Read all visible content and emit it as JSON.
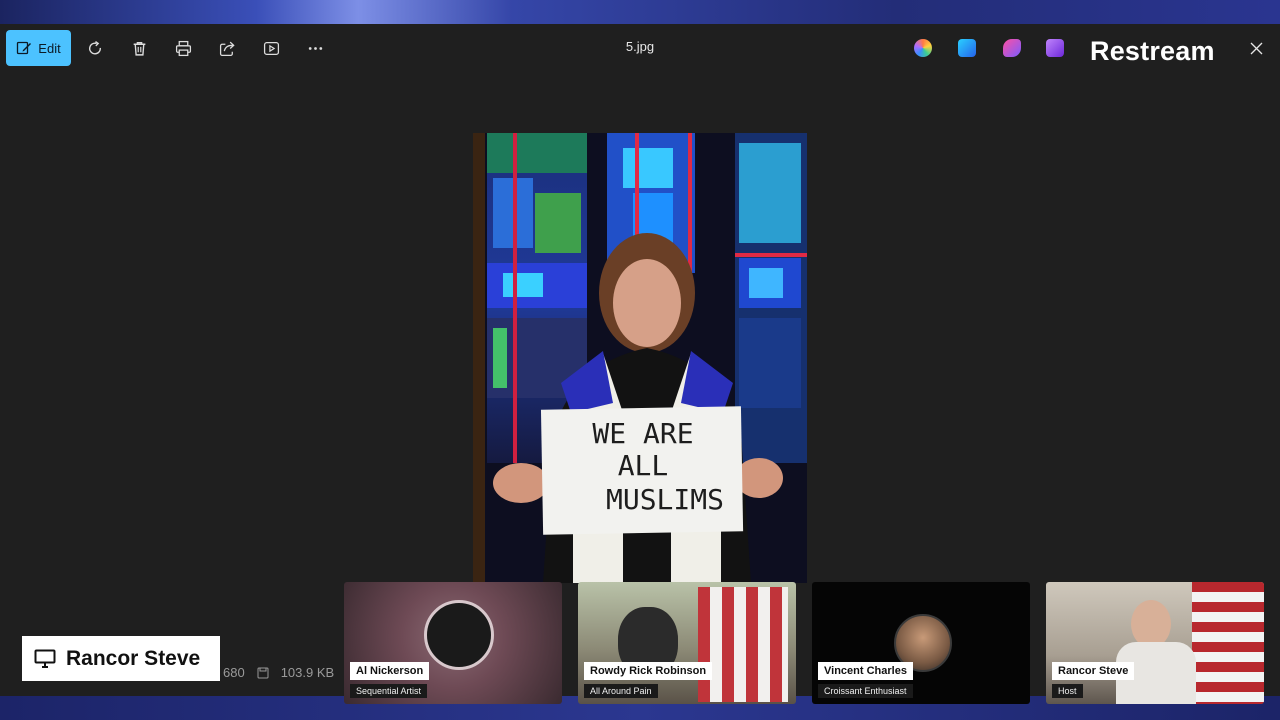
{
  "toolbar": {
    "edit_label": "Edit",
    "file_name": "5.jpg"
  },
  "icons": {
    "edit": "edit-icon",
    "rotate": "rotate-icon",
    "delete": "delete-icon",
    "print": "print-icon",
    "share": "share-icon",
    "slideshow": "slideshow-icon",
    "more": "more-icon",
    "close": "close-icon"
  },
  "brand": {
    "overlay_text": "Restream"
  },
  "photo": {
    "sign_lines": [
      "WE ARE",
      "ALL",
      "MUSLIMS"
    ]
  },
  "status_bar": {
    "dimension_fragment": "680",
    "file_size": "103.9 KB"
  },
  "host_label": {
    "name": "Rancor Steve"
  },
  "participants": [
    {
      "name": "Al Nickerson",
      "role": "Sequential Artist"
    },
    {
      "name": "Rowdy Rick Robinson",
      "role": "All Around Pain"
    },
    {
      "name": "Vincent Charles",
      "role": "Croissant Enthusiast"
    },
    {
      "name": "Rancor Steve",
      "role": "Host"
    }
  ],
  "colors": {
    "accent": "#4cc2ff",
    "background": "#1f1f1f",
    "tag_bg": "#ffffff"
  }
}
